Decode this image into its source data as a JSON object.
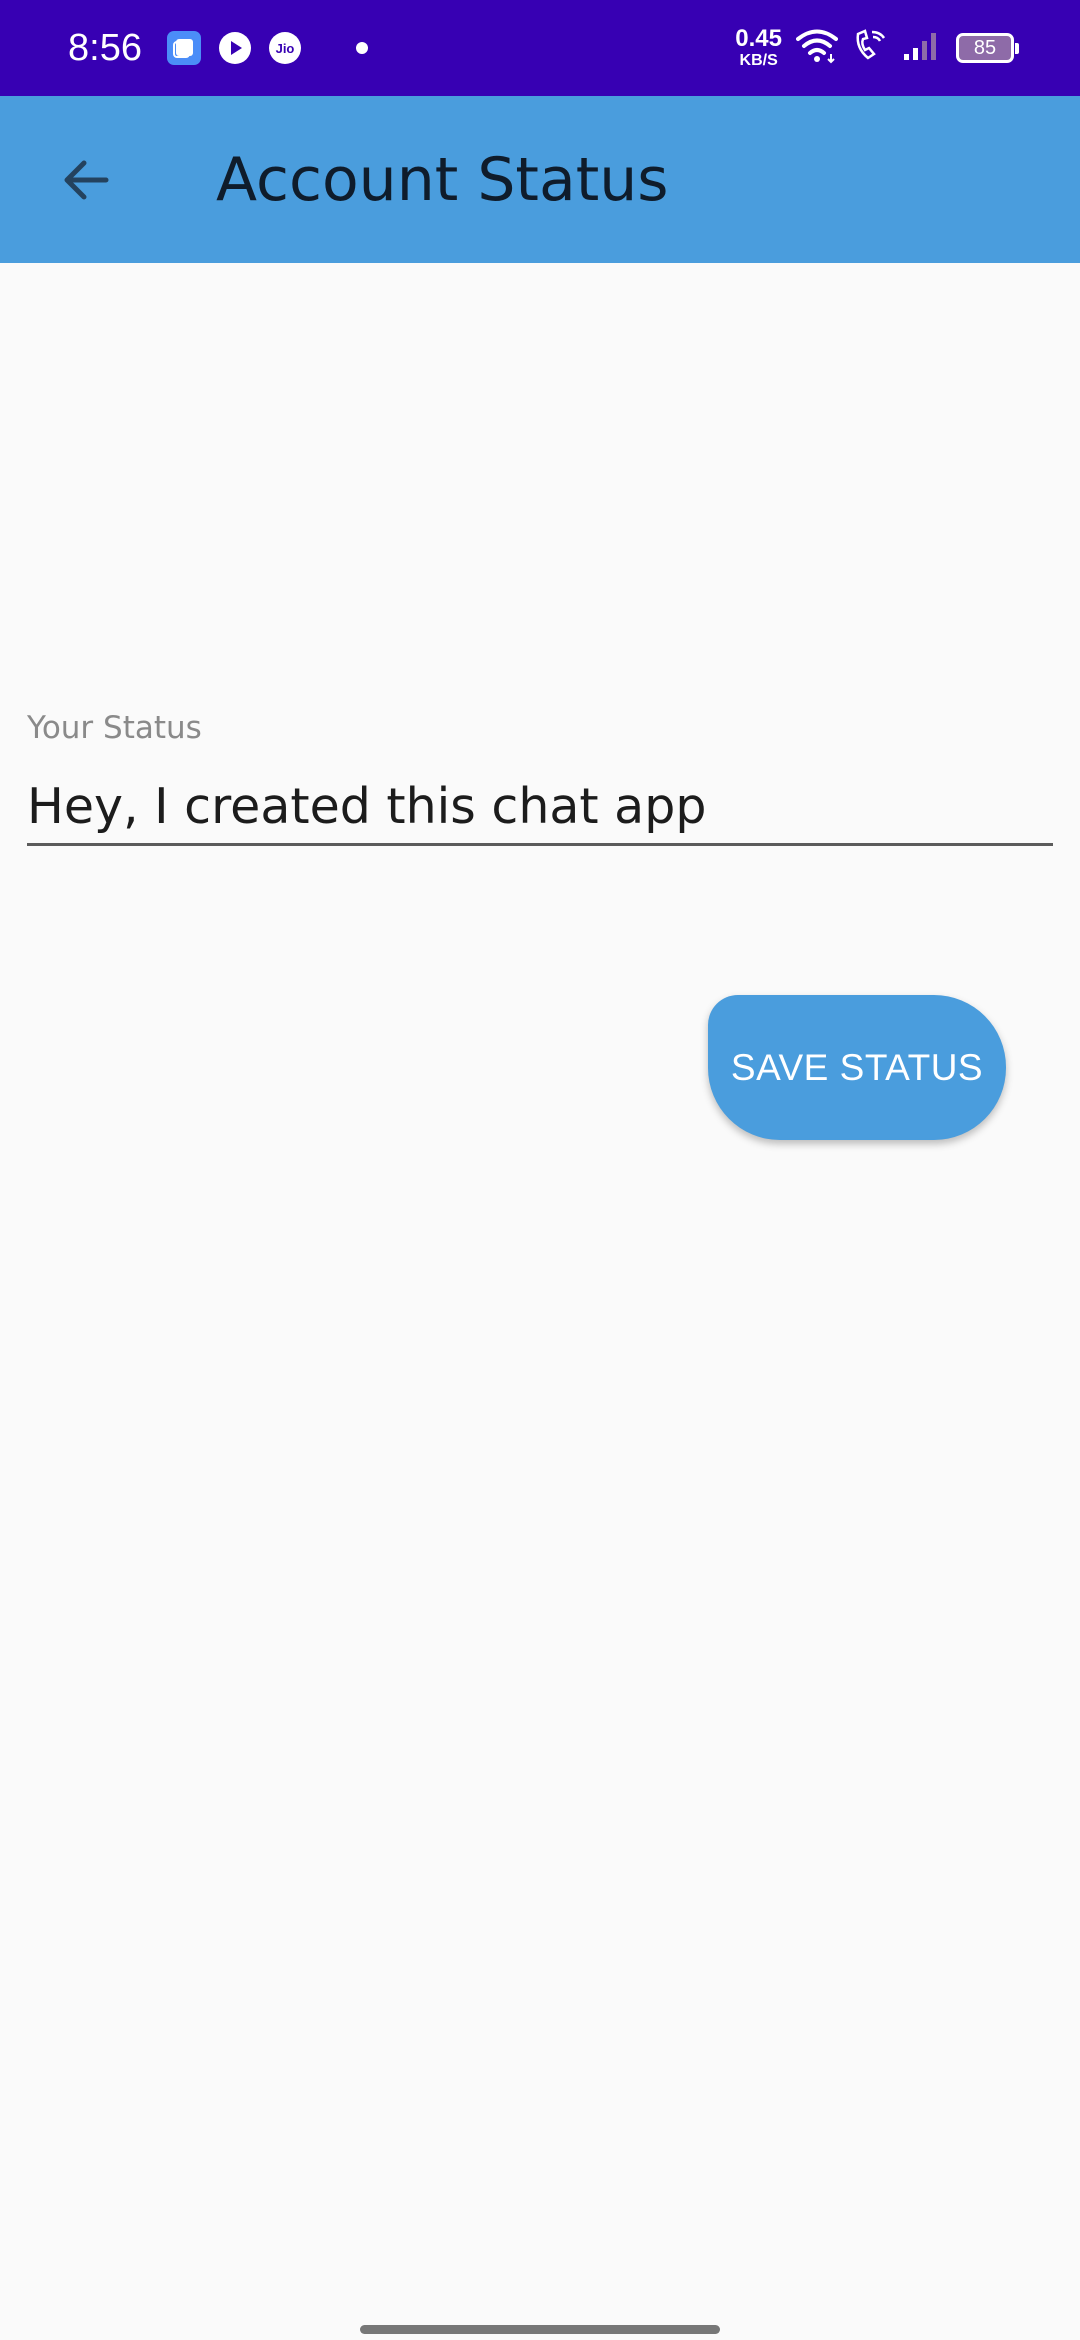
{
  "status_bar": {
    "time": "8:56",
    "net_speed_value": "0.45",
    "net_speed_unit": "KB/S",
    "battery_level": "85",
    "icons": [
      "app-window-icon",
      "play-icon",
      "jio-icon",
      "dot-icon",
      "wifi-icon",
      "wifi-calling-icon",
      "signal-icon",
      "battery-icon"
    ],
    "jio_label": "Jio"
  },
  "app_bar": {
    "title": "Account Status",
    "back_icon": "arrow-left-icon"
  },
  "form": {
    "label": "Your Status",
    "value": "Hey, I created this chat app"
  },
  "actions": {
    "save_label": "SAVE STATUS"
  },
  "colors": {
    "status_bar": "#3700b3",
    "app_bar": "#4a9ddd",
    "button": "#4a9ddd",
    "background": "#fafafa"
  }
}
